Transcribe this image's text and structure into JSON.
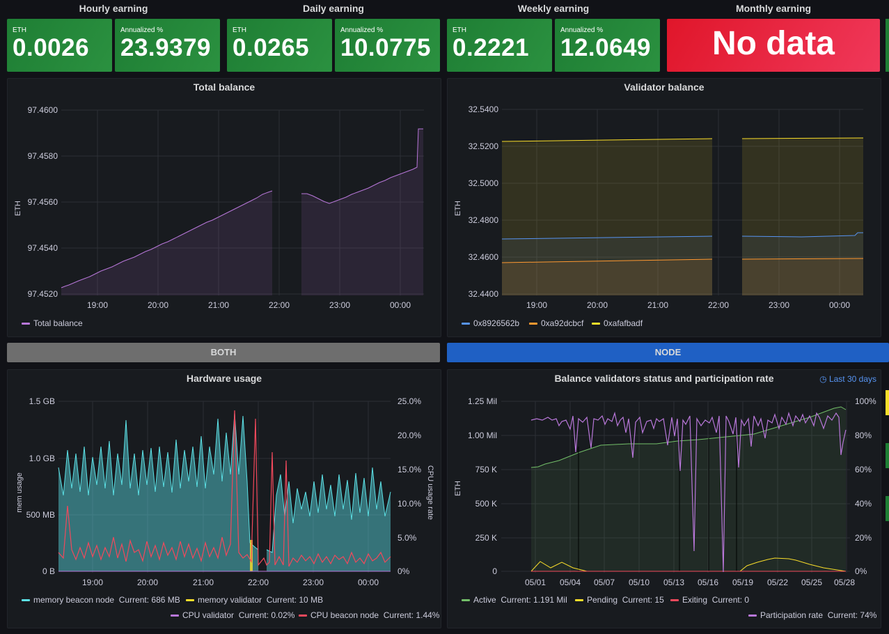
{
  "earnings": [
    {
      "title": "Hourly earning",
      "eth_label": "ETH",
      "eth": "0.0026",
      "ann_label": "Annualized %",
      "ann": "23.9379"
    },
    {
      "title": "Daily earning",
      "eth_label": "ETH",
      "eth": "0.0265",
      "ann_label": "Annualized %",
      "ann": "10.0775"
    },
    {
      "title": "Weekly earning",
      "eth_label": "ETH",
      "eth": "0.2221",
      "ann_label": "Annualized %",
      "ann": "12.0649"
    },
    {
      "title": "Monthly earning",
      "nodata": "No data"
    }
  ],
  "rows": {
    "both": "BOTH",
    "node": "NODE"
  },
  "colors": {
    "purple": "#b877d9",
    "blue": "#5794f2",
    "orange": "#ff9830",
    "yellow": "#fade2a",
    "cyan": "#5ce1e6",
    "red": "#f2495c",
    "green": "#73bf69",
    "row_both": "#6e6e6e",
    "row_node": "#1f60c4"
  },
  "total_balance": {
    "title": "Total balance",
    "ylabel": "ETH",
    "yticks": [
      "97.4600",
      "97.4580",
      "97.4560",
      "97.4540",
      "97.4520"
    ],
    "xticks": [
      "19:00",
      "20:00",
      "21:00",
      "22:00",
      "23:00",
      "00:00"
    ],
    "legend": [
      {
        "name": "Total balance",
        "color": "#b877d9"
      }
    ]
  },
  "validator_balance": {
    "title": "Validator balance",
    "ylabel": "ETH",
    "yticks": [
      "32.5400",
      "32.5200",
      "32.5000",
      "32.4800",
      "32.4600",
      "32.4400"
    ],
    "xticks": [
      "19:00",
      "20:00",
      "21:00",
      "22:00",
      "23:00",
      "00:00"
    ],
    "legend": [
      {
        "name": "0x8926562b",
        "color": "#5794f2"
      },
      {
        "name": "0xa92dcbcf",
        "color": "#ff9830"
      },
      {
        "name": "0xafafbadf",
        "color": "#fade2a"
      }
    ]
  },
  "hardware": {
    "title": "Hardware usage",
    "ylabel_left": "mem usage",
    "ylabel_right": "CPU usage rate",
    "yticks_left": [
      "1.5 GB",
      "1.0 GB",
      "500 MB",
      "0 B"
    ],
    "yticks_right": [
      "25.0%",
      "20.0%",
      "15.0%",
      "10.0%",
      "5.0%",
      "0%"
    ],
    "xticks": [
      "19:00",
      "20:00",
      "21:00",
      "22:00",
      "23:00",
      "00:00"
    ],
    "legend": [
      {
        "name": "memory beacon node",
        "current": "Current: 686 MB",
        "color": "#5ce1e6"
      },
      {
        "name": "memory validator",
        "current": "Current: 10 MB",
        "color": "#fade2a"
      },
      {
        "name": "CPU validator",
        "current": "Current: 0.02%",
        "color": "#b877d9"
      },
      {
        "name": "CPU beacon node",
        "current": "Current: 1.44%",
        "color": "#f2495c"
      }
    ]
  },
  "status": {
    "title": "Balance validators status and participation rate",
    "time_range": "Last 30 days",
    "ylabel": "ETH",
    "yticks_left": [
      "1.25 Mil",
      "1.00 Mil",
      "750 K",
      "500 K",
      "250 K",
      "0"
    ],
    "yticks_right": [
      "100%",
      "80%",
      "60%",
      "40%",
      "20%",
      "0%"
    ],
    "xticks": [
      "05/01",
      "05/04",
      "05/07",
      "05/10",
      "05/13",
      "05/16",
      "05/19",
      "05/22",
      "05/25",
      "05/28"
    ],
    "legend": [
      {
        "name": "Active",
        "current": "Current: 1.191 Mil",
        "color": "#73bf69"
      },
      {
        "name": "Pending",
        "current": "Current: 15",
        "color": "#fade2a"
      },
      {
        "name": "Exiting",
        "current": "Current: 0",
        "color": "#f2495c"
      },
      {
        "name": "Participation rate",
        "current": "Current: 74%",
        "color": "#b877d9"
      }
    ]
  }
}
